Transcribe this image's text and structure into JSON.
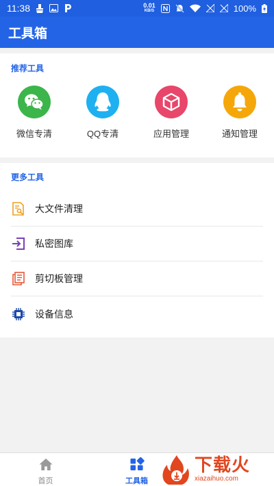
{
  "status": {
    "time": "11:38",
    "net_speed": "0.01",
    "net_unit": "KB/S",
    "battery": "100%"
  },
  "app_bar": {
    "title": "工具箱"
  },
  "recommend": {
    "title": "推荐工具",
    "items": [
      {
        "label": "微信专清",
        "icon": "wechat-icon",
        "color": "#3cb54a"
      },
      {
        "label": "QQ专清",
        "icon": "qq-icon",
        "color": "#1eb0f0"
      },
      {
        "label": "应用管理",
        "icon": "app-box-icon",
        "color": "#e8466a"
      },
      {
        "label": "通知管理",
        "icon": "bell-icon",
        "color": "#f5a70a"
      }
    ]
  },
  "more": {
    "title": "更多工具",
    "items": [
      {
        "label": "大文件清理",
        "icon": "large-file-icon",
        "color": "#f0a020"
      },
      {
        "label": "私密图库",
        "icon": "private-gallery-icon",
        "color": "#7b3fb8"
      },
      {
        "label": "剪切板管理",
        "icon": "clipboard-icon",
        "color": "#e4583a"
      },
      {
        "label": "设备信息",
        "icon": "chip-icon",
        "color": "#1d4aa8"
      }
    ]
  },
  "bottom_nav": {
    "home_label": "首页",
    "toolbox_label": "工具箱"
  },
  "watermark": {
    "big": "下载火",
    "small": "xiazaihuo.com"
  }
}
